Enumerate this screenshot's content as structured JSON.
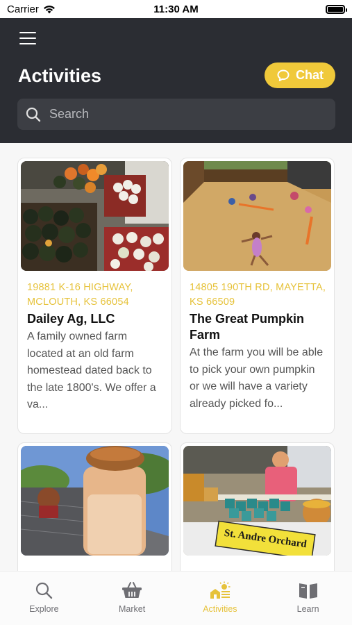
{
  "status_bar": {
    "carrier": "Carrier",
    "time": "11:30 AM"
  },
  "header": {
    "title": "Activities",
    "chat_label": "Chat",
    "search_placeholder": "Search"
  },
  "cards": [
    {
      "address": "19881 K-16 HIGHWAY, MCLOUTH, KS 66054",
      "title": "Dailey Ag, LLC",
      "description": "A family owned farm located at an old farm homestead dated back to the late 1800's. We offer a va..."
    },
    {
      "address": "14805 190TH RD, MAYETTA, KS 66509",
      "title": "The Great Pumpkin Farm",
      "description": "At the farm you will be able to pick your own pumpkin or we will have a variety already picked fo..."
    },
    {
      "address": "",
      "title": "",
      "description": ""
    },
    {
      "address": "",
      "title": "",
      "description": "",
      "sign_text": "St. Andre Orchard"
    }
  ],
  "tabs": [
    {
      "label": "Explore",
      "icon": "search-icon",
      "active": false
    },
    {
      "label": "Market",
      "icon": "basket-icon",
      "active": false
    },
    {
      "label": "Activities",
      "icon": "farm-sun-icon",
      "active": true
    },
    {
      "label": "Learn",
      "icon": "book-icon",
      "active": false
    }
  ],
  "colors": {
    "accent": "#f0c93a",
    "header_bg": "#2b2d33",
    "address": "#e6c23a"
  }
}
